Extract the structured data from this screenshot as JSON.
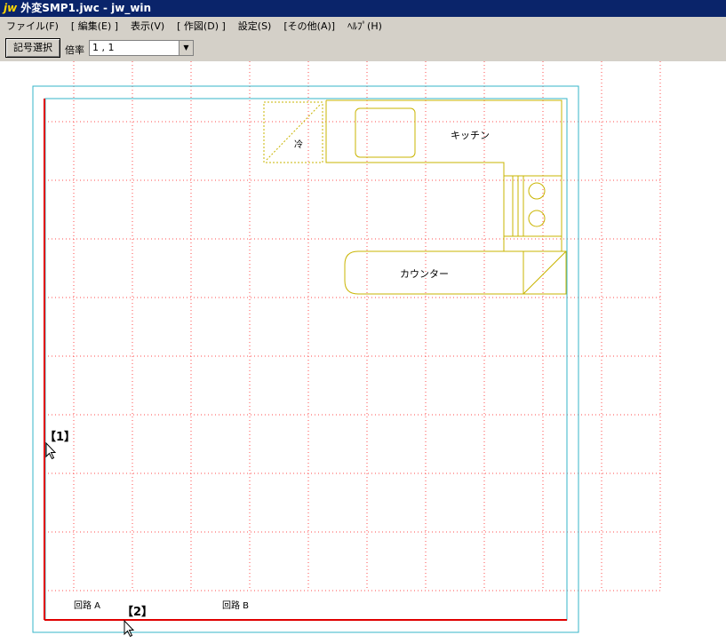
{
  "window": {
    "app_badge": "jw",
    "title": "外変SMP1.jwc - jw_win"
  },
  "menu": [
    "ファイル(F)",
    "[ 編集(E) ]",
    "表示(V)",
    "[ 作図(D) ]",
    "設定(S)",
    "[その他(A)]",
    "ﾍﾙﾌﾟ(H)"
  ],
  "toolbar": {
    "symbol_select_label": "記号選択",
    "scale_label": "倍率",
    "scale_value": "1 , 1"
  },
  "drawing": {
    "kitchen_label": "キッチン",
    "counter_label": "カウンター",
    "fridge_label": "冷",
    "marker_1": "【1】",
    "marker_2": "【2】",
    "circuit_a": "回路 A",
    "circuit_b": "回路 B"
  },
  "colors": {
    "grid": "#ff4d4d",
    "outline": "#36b4c8",
    "fixture": "#c9b400",
    "wall": "#e00000",
    "ui_face": "#d4d0c8",
    "titlebar": "#0a246a"
  }
}
